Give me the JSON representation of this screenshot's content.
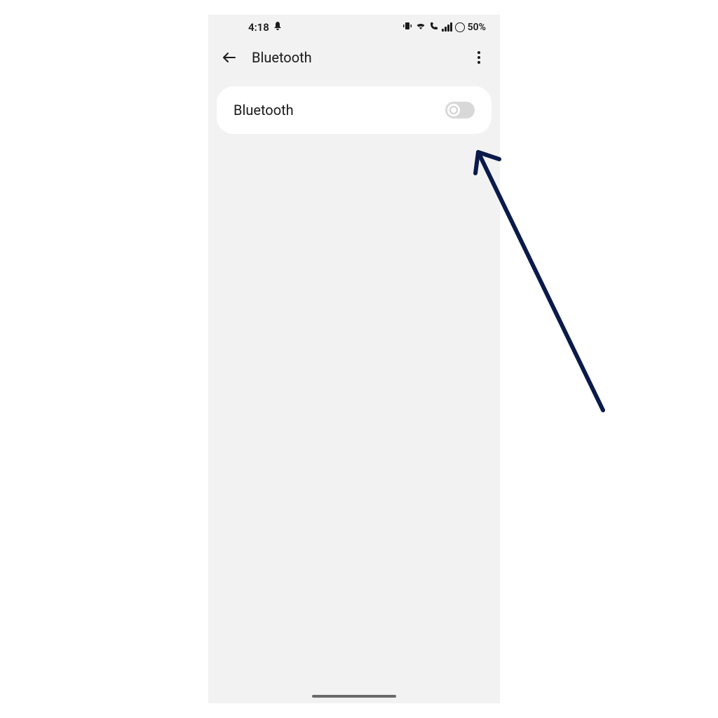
{
  "status_bar": {
    "time": "4:18",
    "battery_percent": "50%"
  },
  "nav": {
    "title": "Bluetooth"
  },
  "setting": {
    "bluetooth_label": "Bluetooth",
    "toggle_state": "off"
  },
  "annotation": {
    "arrow_color": "#0a1a4a"
  }
}
